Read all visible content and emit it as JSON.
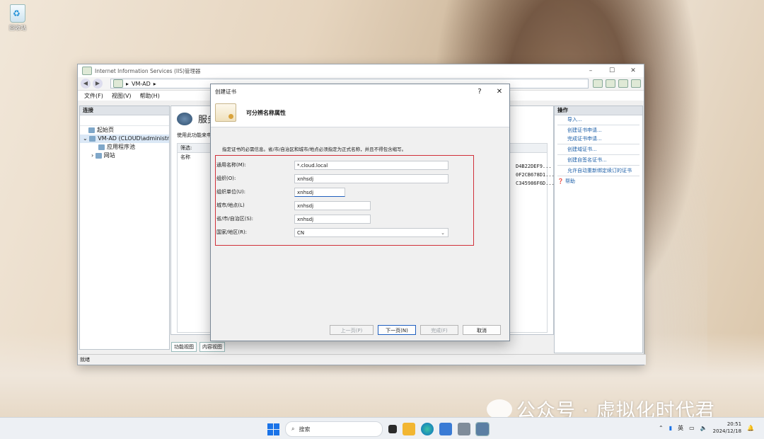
{
  "desktop": {
    "recycle_bin_label": "回收站",
    "watermark_text": "公众号 · 虚拟化时代君"
  },
  "iis": {
    "title": "Internet Information Services (IIS)管理器",
    "window_controls": [
      "–",
      "☐",
      "✕"
    ],
    "address": [
      "VM-AD",
      "▸"
    ],
    "menu": [
      "文件(F)",
      "视图(V)",
      "帮助(H)"
    ],
    "connections": {
      "header": "连接",
      "items": [
        "起始页",
        "VM-AD (CLOUD\\administrator)",
        "应用程序池",
        "网站"
      ]
    },
    "main": {
      "title": "服务器证书",
      "description": "使用此功能来申请和管理 Web 服务器可以对配置了 SSL 的网站使用的证书。",
      "filter_label": "筛选:",
      "name_col": "名称",
      "hashes": [
        "D4B22DEF9...",
        "0F2CB678D1...",
        "C345986F6D..."
      ],
      "view_tabs": [
        "功能视图",
        "内容视图"
      ]
    },
    "actions": {
      "header": "操作",
      "items": [
        "导入...",
        "创建证书申请...",
        "完成证书申请...",
        "创建域证书...",
        "创建自签名证书...",
        "允许自动重新绑定续订的证书",
        "帮助"
      ]
    },
    "status": "就绪"
  },
  "dialog": {
    "title": "创建证书",
    "controls": [
      "?",
      "✕"
    ],
    "heading": "可分辨名称属性",
    "description": "指定证书的必需信息。省/市/自治区和城市/地点必须指定为正式名称，并且不得包含缩写。",
    "fields": [
      {
        "label": "通用名称(M):",
        "value": "*.cloud.local"
      },
      {
        "label": "组织(O):",
        "value": "xnhsdj"
      },
      {
        "label": "组织单位(U):",
        "value": "xnhsdj"
      },
      {
        "label": "城市/地点(L)",
        "value": "xnhsdj"
      },
      {
        "label": "省/市/自治区(S):",
        "value": "xnhsdj"
      },
      {
        "label": "国家/地区(R):",
        "value": "CN"
      }
    ],
    "buttons": {
      "prev": "上一页(P)",
      "next": "下一页(N)",
      "finish": "完成(F)",
      "cancel": "取消"
    }
  },
  "taskbar": {
    "search_placeholder": "搜索",
    "ime": "英",
    "time": "20:51",
    "date": "2024/12/18"
  },
  "colors": {
    "highlight_box": "#d0303a",
    "accent": "#1f5fbf",
    "link": "#1c5fa8"
  }
}
